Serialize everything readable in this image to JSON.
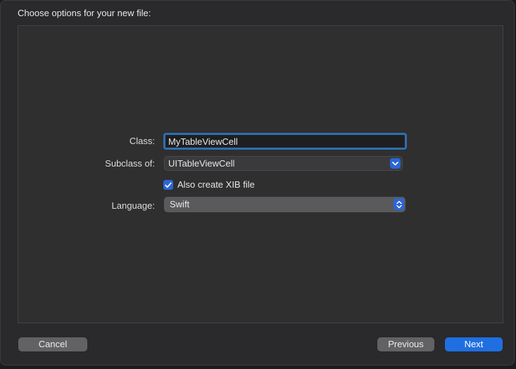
{
  "sheet": {
    "title": "Choose options for your new file:"
  },
  "form": {
    "class_label": "Class:",
    "class_value": "MyTableViewCell",
    "subclass_label": "Subclass of:",
    "subclass_value": "UITableViewCell",
    "xib_label": "Also create XIB file",
    "xib_checked": true,
    "language_label": "Language:",
    "language_value": "Swift"
  },
  "buttons": {
    "cancel": "Cancel",
    "previous": "Previous",
    "next": "Next"
  },
  "colors": {
    "accent": "#2a66d6",
    "focus_ring": "#2f6fb0",
    "primary_button": "#1f6fe0"
  },
  "icons": {
    "subclass_popup": "chevron-down-icon",
    "language_popup": "chevron-up-down-icon",
    "checkbox": "checkmark-icon"
  }
}
